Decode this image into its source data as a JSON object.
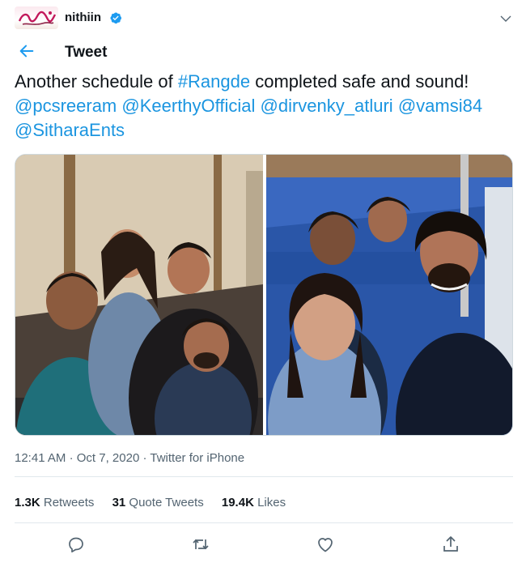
{
  "account": {
    "username": "nithiin",
    "verified": true
  },
  "header": {
    "title": "Tweet"
  },
  "tweet": {
    "text_plain_1": "Another schedule of ",
    "hashtag": "#Rangde",
    "text_plain_2": " completed safe and sound! ",
    "mention_1": "@pcsreeram",
    "mention_2": "@KeerthyOfficial",
    "mention_3": "@dirvenky_atluri",
    "mention_4": "@vamsi84",
    "mention_5": "@SitharaEnts",
    "time": "12:41 AM",
    "date": "Oct 7, 2020",
    "source": "Twitter for iPhone",
    "dot": "·"
  },
  "stats": {
    "retweets_count": "1.3K",
    "retweets_label": "Retweets",
    "quotes_count": "31",
    "quotes_label": "Quote Tweets",
    "likes_count": "19.4K",
    "likes_label": "Likes"
  },
  "colors": {
    "link": "#1b95e0",
    "verified": "#1d9bf0",
    "muted": "#536471"
  },
  "icons": {
    "reply": "reply-icon",
    "retweet": "retweet-icon",
    "like": "heart-icon",
    "share": "share-icon"
  }
}
